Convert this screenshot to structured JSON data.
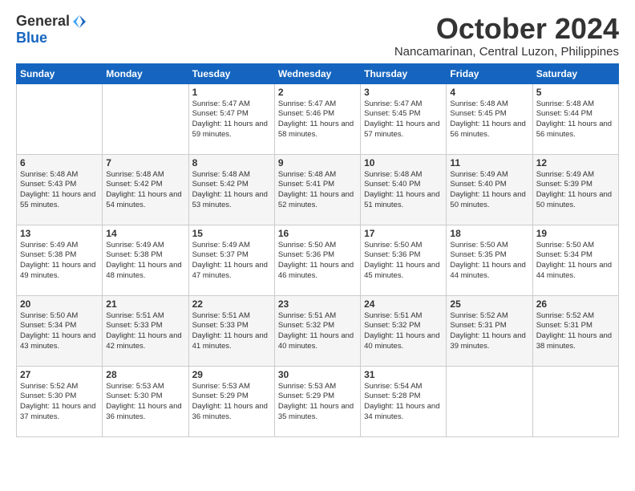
{
  "logo": {
    "general": "General",
    "blue": "Blue"
  },
  "title": "October 2024",
  "location": "Nancamarinan, Central Luzon, Philippines",
  "days_of_week": [
    "Sunday",
    "Monday",
    "Tuesday",
    "Wednesday",
    "Thursday",
    "Friday",
    "Saturday"
  ],
  "weeks": [
    [
      {
        "day": "",
        "info": ""
      },
      {
        "day": "",
        "info": ""
      },
      {
        "day": "1",
        "info": "Sunrise: 5:47 AM\nSunset: 5:47 PM\nDaylight: 11 hours\nand 59 minutes."
      },
      {
        "day": "2",
        "info": "Sunrise: 5:47 AM\nSunset: 5:46 PM\nDaylight: 11 hours\nand 58 minutes."
      },
      {
        "day": "3",
        "info": "Sunrise: 5:47 AM\nSunset: 5:45 PM\nDaylight: 11 hours\nand 57 minutes."
      },
      {
        "day": "4",
        "info": "Sunrise: 5:48 AM\nSunset: 5:45 PM\nDaylight: 11 hours\nand 56 minutes."
      },
      {
        "day": "5",
        "info": "Sunrise: 5:48 AM\nSunset: 5:44 PM\nDaylight: 11 hours\nand 56 minutes."
      }
    ],
    [
      {
        "day": "6",
        "info": "Sunrise: 5:48 AM\nSunset: 5:43 PM\nDaylight: 11 hours\nand 55 minutes."
      },
      {
        "day": "7",
        "info": "Sunrise: 5:48 AM\nSunset: 5:42 PM\nDaylight: 11 hours\nand 54 minutes."
      },
      {
        "day": "8",
        "info": "Sunrise: 5:48 AM\nSunset: 5:42 PM\nDaylight: 11 hours\nand 53 minutes."
      },
      {
        "day": "9",
        "info": "Sunrise: 5:48 AM\nSunset: 5:41 PM\nDaylight: 11 hours\nand 52 minutes."
      },
      {
        "day": "10",
        "info": "Sunrise: 5:48 AM\nSunset: 5:40 PM\nDaylight: 11 hours\nand 51 minutes."
      },
      {
        "day": "11",
        "info": "Sunrise: 5:49 AM\nSunset: 5:40 PM\nDaylight: 11 hours\nand 50 minutes."
      },
      {
        "day": "12",
        "info": "Sunrise: 5:49 AM\nSunset: 5:39 PM\nDaylight: 11 hours\nand 50 minutes."
      }
    ],
    [
      {
        "day": "13",
        "info": "Sunrise: 5:49 AM\nSunset: 5:38 PM\nDaylight: 11 hours\nand 49 minutes."
      },
      {
        "day": "14",
        "info": "Sunrise: 5:49 AM\nSunset: 5:38 PM\nDaylight: 11 hours\nand 48 minutes."
      },
      {
        "day": "15",
        "info": "Sunrise: 5:49 AM\nSunset: 5:37 PM\nDaylight: 11 hours\nand 47 minutes."
      },
      {
        "day": "16",
        "info": "Sunrise: 5:50 AM\nSunset: 5:36 PM\nDaylight: 11 hours\nand 46 minutes."
      },
      {
        "day": "17",
        "info": "Sunrise: 5:50 AM\nSunset: 5:36 PM\nDaylight: 11 hours\nand 45 minutes."
      },
      {
        "day": "18",
        "info": "Sunrise: 5:50 AM\nSunset: 5:35 PM\nDaylight: 11 hours\nand 44 minutes."
      },
      {
        "day": "19",
        "info": "Sunrise: 5:50 AM\nSunset: 5:34 PM\nDaylight: 11 hours\nand 44 minutes."
      }
    ],
    [
      {
        "day": "20",
        "info": "Sunrise: 5:50 AM\nSunset: 5:34 PM\nDaylight: 11 hours\nand 43 minutes."
      },
      {
        "day": "21",
        "info": "Sunrise: 5:51 AM\nSunset: 5:33 PM\nDaylight: 11 hours\nand 42 minutes."
      },
      {
        "day": "22",
        "info": "Sunrise: 5:51 AM\nSunset: 5:33 PM\nDaylight: 11 hours\nand 41 minutes."
      },
      {
        "day": "23",
        "info": "Sunrise: 5:51 AM\nSunset: 5:32 PM\nDaylight: 11 hours\nand 40 minutes."
      },
      {
        "day": "24",
        "info": "Sunrise: 5:51 AM\nSunset: 5:32 PM\nDaylight: 11 hours\nand 40 minutes."
      },
      {
        "day": "25",
        "info": "Sunrise: 5:52 AM\nSunset: 5:31 PM\nDaylight: 11 hours\nand 39 minutes."
      },
      {
        "day": "26",
        "info": "Sunrise: 5:52 AM\nSunset: 5:31 PM\nDaylight: 11 hours\nand 38 minutes."
      }
    ],
    [
      {
        "day": "27",
        "info": "Sunrise: 5:52 AM\nSunset: 5:30 PM\nDaylight: 11 hours\nand 37 minutes."
      },
      {
        "day": "28",
        "info": "Sunrise: 5:53 AM\nSunset: 5:30 PM\nDaylight: 11 hours\nand 36 minutes."
      },
      {
        "day": "29",
        "info": "Sunrise: 5:53 AM\nSunset: 5:29 PM\nDaylight: 11 hours\nand 36 minutes."
      },
      {
        "day": "30",
        "info": "Sunrise: 5:53 AM\nSunset: 5:29 PM\nDaylight: 11 hours\nand 35 minutes."
      },
      {
        "day": "31",
        "info": "Sunrise: 5:54 AM\nSunset: 5:28 PM\nDaylight: 11 hours\nand 34 minutes."
      },
      {
        "day": "",
        "info": ""
      },
      {
        "day": "",
        "info": ""
      }
    ]
  ]
}
